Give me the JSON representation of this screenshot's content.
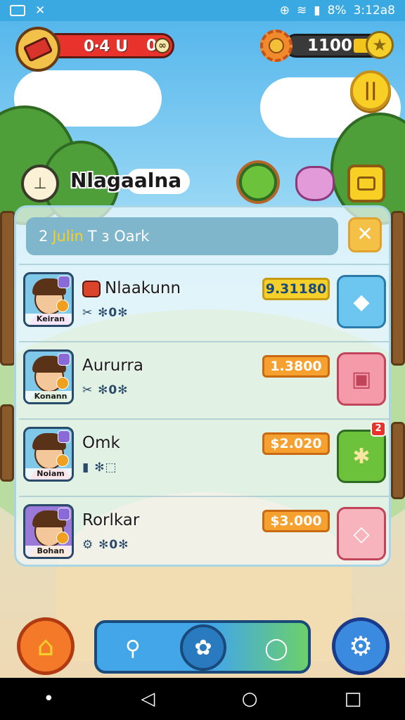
{
  "status_bar": {
    "battery": "8%",
    "time": "3:12a8"
  },
  "hud": {
    "tickets": {
      "left": "0ꞏ4 U",
      "right": "00"
    },
    "coins": "1100"
  },
  "location": {
    "title": "Nlagaalna"
  },
  "panel": {
    "header_num": "2",
    "header_highlight": "Julin",
    "header_rest": "T ɜ Oark",
    "close_label": "✕"
  },
  "rows": [
    {
      "name": "Nlaakunn",
      "tag": "Keiran",
      "stats": "✂ ✻0✻",
      "price": "9.31180",
      "price_style": "yellow",
      "shirt": "#c05ad0",
      "bg": "#7fc8e8",
      "action_icon": "◆",
      "action": "blue"
    },
    {
      "name": "Aururra",
      "tag": "Konann",
      "stats": "✂ ✻0✻",
      "price": "1.3800",
      "price_style": "orange",
      "shirt": "#4aa830",
      "bg": "#7fc8e8",
      "action_icon": "▣",
      "action": "pink"
    },
    {
      "name": "Omk",
      "tag": "Noiam",
      "stats": "▮ ✻⬚",
      "price": "$2.020",
      "price_style": "orange",
      "shirt": "#e35a7a",
      "bg": "#7fc8e8",
      "action_icon": "✱",
      "action": "green",
      "badge": "2"
    },
    {
      "name": "Rorlkar",
      "tag": "Bohan",
      "stats": "⚙ ✻0✻",
      "price": "$3.000",
      "price_style": "orange",
      "shirt": "#f07a2a",
      "bg": "#9a7ad8",
      "action_icon": "◇",
      "action": "rose"
    }
  ],
  "colors": {
    "sky": "#4fb3ea",
    "panel_border": "#a8d6e6",
    "accent_yellow": "#f7cf25",
    "home_orange": "#f47a2a",
    "settings_blue": "#3a8ae0"
  },
  "icons": {
    "home": "home-icon",
    "search": "search-icon",
    "daisy": "flower-icon",
    "chat": "chat-icon",
    "settings": "gear-icon"
  }
}
